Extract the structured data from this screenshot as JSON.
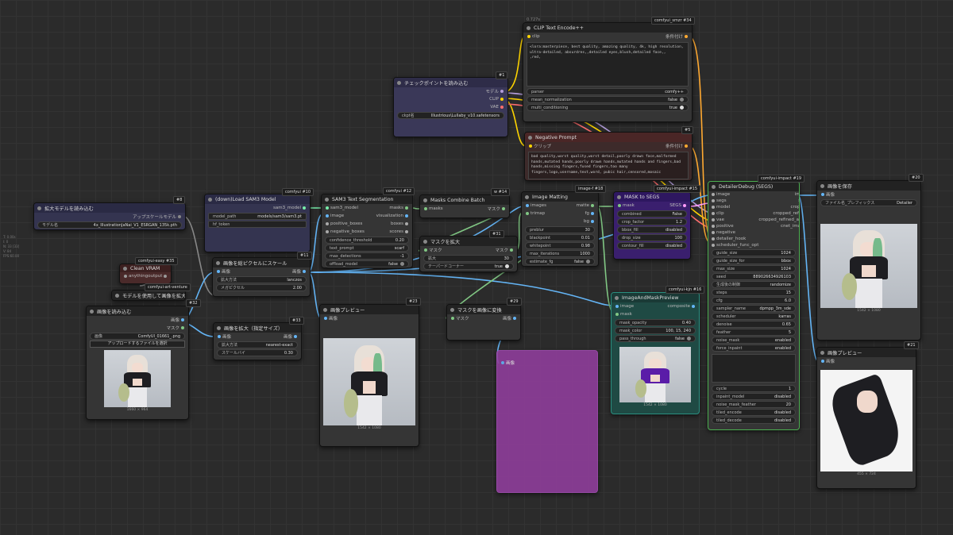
{
  "side_info": [
    "T: 0.00s",
    "I: 0",
    "N: 33 [33]",
    "V: 84",
    "FPS:60.00"
  ],
  "nodes": {
    "clip_encode": {
      "title": "CLIP Text Encode++",
      "badge": "comfyui_smzr #34",
      "perc": "0.727s",
      "in_clip": "clip",
      "out_cond": "条件付け",
      "text": "<lora:masterpiece, best quality, amazing quality, 4k, high resolution, ultra-detailed, absurdres,,detailed eyes,blush,detailed face,,\n,red,",
      "w_parser_l": "parser",
      "w_parser_v": "comfy++",
      "w_mean_l": "mean_normalization",
      "w_mean_v": "false",
      "w_multi_l": "multi_conditioning",
      "w_multi_v": "true"
    },
    "checkpoint": {
      "title": "チェックポイントを読み込む",
      "badge": "#1",
      "out_model": "モデル",
      "out_clip": "CLIP",
      "out_vae": "VAE",
      "w_ckpt_l": "ckpt名",
      "w_ckpt_v": "Illustrious\\Lullaby_v10.safetensors"
    },
    "negative": {
      "title": "Negative Prompt",
      "badge": "#5",
      "in_clip": "クリップ",
      "out_cond": "条件付け",
      "text": "bad quality,worst quality,worst detail,poorly drawn face,malformed hands,mutated hands,poorly drawn hands,mutated hands and fingers,bad hands,missing fingers,fused fingers,too many fingers,logo,username,text,word, pubic hair,censored,mosaic"
    },
    "upscale_loader": {
      "title": "拡大モデルを読み込む",
      "badge": "#8",
      "out": "アップスケールモデル",
      "w_l": "モデル名",
      "w_v": "4x_IllustrationJaNai_V1_ESRGAN_135k.pth"
    },
    "sam3_load": {
      "title": "(down)Load SAM3 Model",
      "badge": "comfyui #10",
      "out": "sam3_model",
      "w1_l": "model_path",
      "w1_v": "models/sam3/sam3.pt",
      "w2_l": "hf_token",
      "w2_v": ""
    },
    "sam3_seg": {
      "title": "SAM3 Text Segmentation",
      "badge": "comfyui #12",
      "in1": "sam3_model",
      "in2": "image",
      "in3": "positive_boxes",
      "in4": "negative_boxes",
      "out1": "masks",
      "out2": "visualization",
      "out3": "boxes",
      "out4": "scores",
      "w1_l": "confidence_threshold",
      "w1_v": "0.20",
      "w2_l": "text_prompt",
      "w2_v": "scarf",
      "w3_l": "max_detections",
      "w3_v": "-1",
      "w4_l": "offload_model",
      "w4_v": "false"
    },
    "masks_combine": {
      "title": "Masks Combine Batch",
      "badge": "w #14",
      "in": "masks",
      "out": "マスク"
    },
    "mask_grow": {
      "title": "マスクを拡大",
      "badge": "#31",
      "in": "マスク",
      "out": "マスク",
      "w1_l": "拡大",
      "w1_v": "30",
      "w2_l": "テーパードコーナー",
      "w2_v": "true"
    },
    "image_matting": {
      "title": "Image Matting",
      "badge": "image-f #18",
      "in1": "images",
      "in2": "trimap",
      "out1": "matte",
      "out2": "fg",
      "out3": "bg",
      "w1_l": "preblur",
      "w1_v": "30",
      "w2_l": "blackpoint",
      "w2_v": "0.01",
      "w3_l": "whitepoint",
      "w3_v": "0.98",
      "w4_l": "max_iterations",
      "w4_v": "1000",
      "w5_l": "estimate_fg",
      "w5_v": "false"
    },
    "mask_to_segs": {
      "title": "MASK to SEGS",
      "badge": "comfyui-impact #15",
      "in": "mask",
      "out": "SEGS",
      "w1_l": "combined",
      "w1_v": "False",
      "w2_l": "crop_factor",
      "w2_v": "1.2",
      "w3_l": "bbox_fill",
      "w3_v": "disabled",
      "w4_l": "drop_size",
      "w4_v": "100",
      "w5_l": "contour_fill",
      "w5_v": "disabled"
    },
    "detailer": {
      "title": "DetailerDebug (SEGS)",
      "badge": "comfyui-impact #19",
      "inputs": [
        "image",
        "segs",
        "model",
        "clip",
        "vae",
        "positive",
        "negative",
        "detailer_hook",
        "scheduler_func_opt"
      ],
      "outputs": [
        "image",
        "segs",
        "cropped",
        "cropped_refined",
        "cropped_refined_alpha",
        "cnet_images"
      ],
      "widgets": [
        {
          "l": "guide_size",
          "v": "1024"
        },
        {
          "l": "guide_size_for",
          "v": "bbox"
        },
        {
          "l": "max_size",
          "v": "1024"
        },
        {
          "l": "seed",
          "v": "889026634926103"
        },
        {
          "l": "生成後の制御",
          "v": "randomize"
        },
        {
          "l": "steps",
          "v": "15"
        },
        {
          "l": "cfg",
          "v": "6.0"
        },
        {
          "l": "sampler_name",
          "v": "dpmpp_3m_sde"
        },
        {
          "l": "scheduler",
          "v": "karras"
        },
        {
          "l": "denoise",
          "v": "0.65"
        },
        {
          "l": "feather",
          "v": "5"
        },
        {
          "l": "noise_mask",
          "v": "enabled"
        },
        {
          "l": "force_inpaint",
          "v": "enabled"
        }
      ],
      "widgets2": [
        {
          "l": "cycle",
          "v": "1"
        },
        {
          "l": "inpaint_model",
          "v": "disabled"
        },
        {
          "l": "noise_mask_feather",
          "v": "20"
        },
        {
          "l": "tiled_encode",
          "v": "disabled"
        },
        {
          "l": "tiled_decode",
          "v": "disabled"
        }
      ]
    },
    "save_image": {
      "title": "画像を保存",
      "badge": "#20",
      "in": "画像",
      "w_l": "ファイル名_プレフィックス",
      "w_v": "Detailer",
      "size": "1542 × 1080"
    },
    "preview2": {
      "title": "画像プレビュー",
      "badge": "#21",
      "in": "画像",
      "size": "455 × 724"
    },
    "clean_vram": {
      "title": "Clean VRAM",
      "badge": "comfyui-easy #35",
      "in": "anything",
      "out": "output"
    },
    "model_upscale": {
      "title": "モデルを使用して画像を拡大",
      "badge": "comfyui-art-venture"
    },
    "scale_pixels": {
      "title": "画像を総ピクセルにスケール",
      "badge": "#11",
      "in": "画像",
      "out": "画像",
      "w1_l": "拡大方法",
      "w1_v": "lanczos",
      "w2_l": "メガピクセル",
      "w2_v": "2.00"
    },
    "load_image": {
      "title": "画像を読み込む",
      "badge": "#32",
      "out1": "画像",
      "out2": "マスク",
      "w_l": "画像",
      "w_v": "ComfyUI_01661_.png",
      "btn": "アップロードするファイルを選択",
      "size": "1660 × 964"
    },
    "scale_factor": {
      "title": "画像を拡大（指定サイズ）",
      "badge": "#33",
      "in": "画像",
      "out": "画像",
      "w1_l": "拡大方法",
      "w1_v": "nearest-exact",
      "w2_l": "スケールバイ",
      "w2_v": "0.30"
    },
    "preview1": {
      "title": "画像プレビュー",
      "badge": "#23",
      "in": "画像",
      "size": "1542 × 1080"
    },
    "mask_to_image": {
      "title": "マスクを画像に変換",
      "badge": "#29",
      "in": "マスク",
      "out": "画像"
    },
    "image_mask_preview": {
      "title": "ImageAndMaskPreview",
      "badge": "comfyui-kjn #16",
      "in1": "image",
      "in2": "mask",
      "out": "composite",
      "w1_l": "mask_opacity",
      "w1_v": "0.40",
      "w2_l": "mask_color",
      "w2_v": "100, 15, 240",
      "w3_l": "pass_through",
      "w3_v": "false",
      "size": "1542 × 1080"
    },
    "purple": {
      "in": "画像"
    }
  },
  "colors": {
    "model": "#b39ddb",
    "clip": "#ffd500",
    "vae": "#ff6e6e",
    "cond": "#ffa931",
    "image": "#64b5f6",
    "mask": "#81c784",
    "segs": "#ff9cf9",
    "bg": "#2b2b2b"
  }
}
